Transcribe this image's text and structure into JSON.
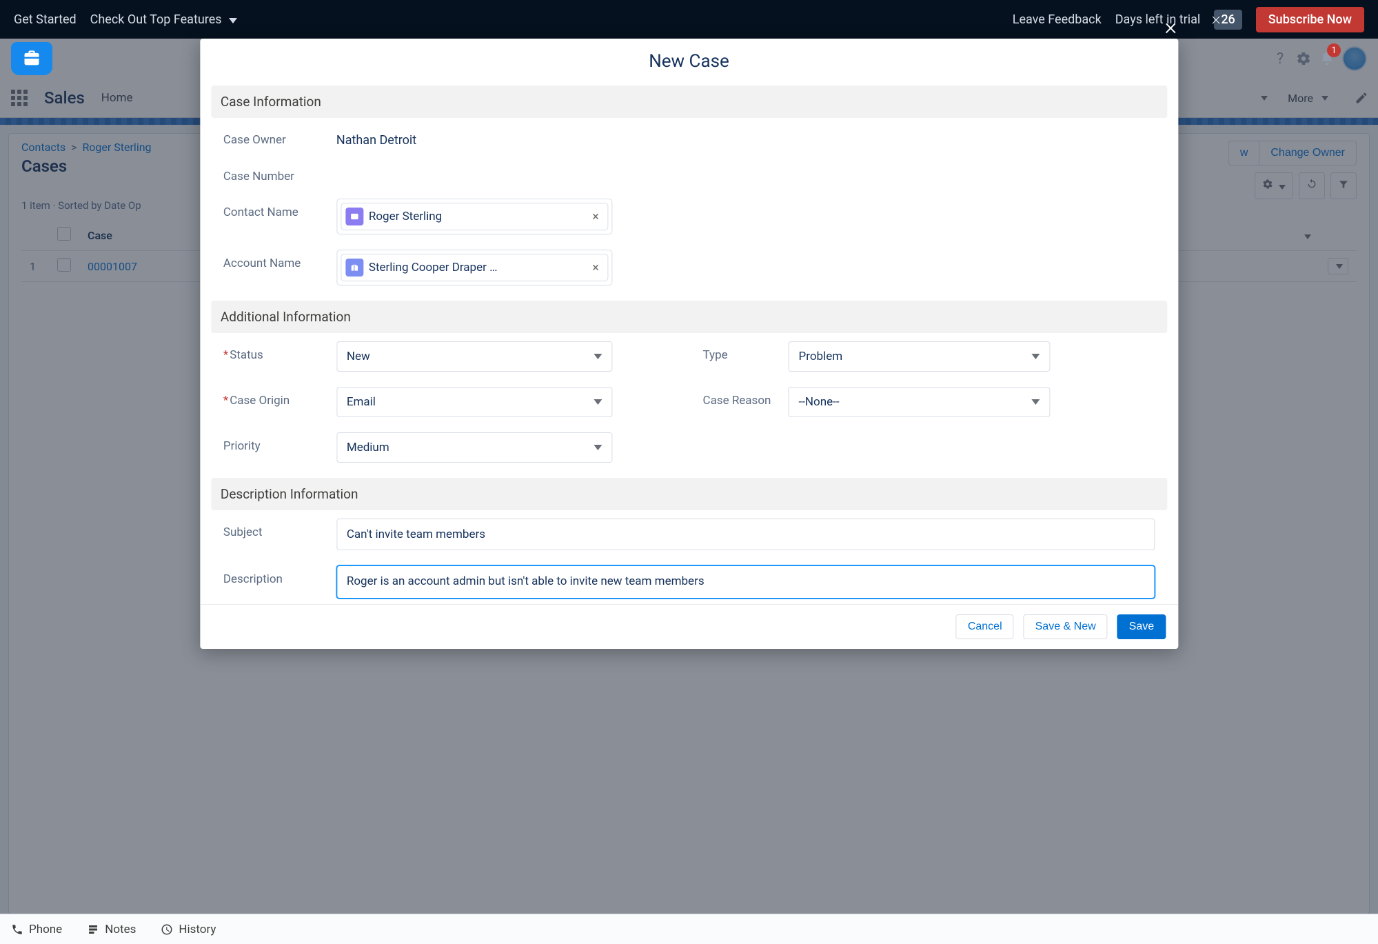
{
  "top_bar": {
    "get_started": "Get Started",
    "features": "Check Out Top Features",
    "leave_feedback": "Leave Feedback",
    "days_left_prefix": "Days left in trial",
    "days_left_value": "26",
    "subscribe": "Subscribe Now"
  },
  "header": {
    "notif_count": "1",
    "app_name": "Sales",
    "nav_home": "Home",
    "nav_more": "More"
  },
  "record": {
    "breadcrumb_root": "Contacts",
    "breadcrumb_parent": "Roger Sterling",
    "title": "Cases",
    "item_summary": "1 item · Sorted by Date Op",
    "change_owner": "Change Owner",
    "col_case": "Case",
    "row1_num": "1",
    "row1_case": "00001007"
  },
  "bottom": {
    "phone": "Phone",
    "notes": "Notes",
    "history": "History"
  },
  "modal": {
    "title": "New Case",
    "section_case_info": "Case Information",
    "case_owner_label": "Case Owner",
    "case_owner_value": "Nathan Detroit",
    "case_number_label": "Case Number",
    "contact_name_label": "Contact Name",
    "contact_name_value": "Roger Sterling",
    "account_name_label": "Account Name",
    "account_name_value": "Sterling Cooper Draper …",
    "section_additional": "Additional Information",
    "status_label": "Status",
    "status_value": "New",
    "type_label": "Type",
    "type_value": "Problem",
    "case_origin_label": "Case Origin",
    "case_origin_value": "Email",
    "case_reason_label": "Case Reason",
    "case_reason_value": "--None--",
    "priority_label": "Priority",
    "priority_value": "Medium",
    "section_description": "Description Information",
    "subject_label": "Subject",
    "subject_value": "Can't invite team members",
    "description_label": "Description",
    "description_value": "Roger is an account admin but isn't able to invite new team members",
    "cancel": "Cancel",
    "save_new": "Save & New",
    "save": "Save"
  }
}
